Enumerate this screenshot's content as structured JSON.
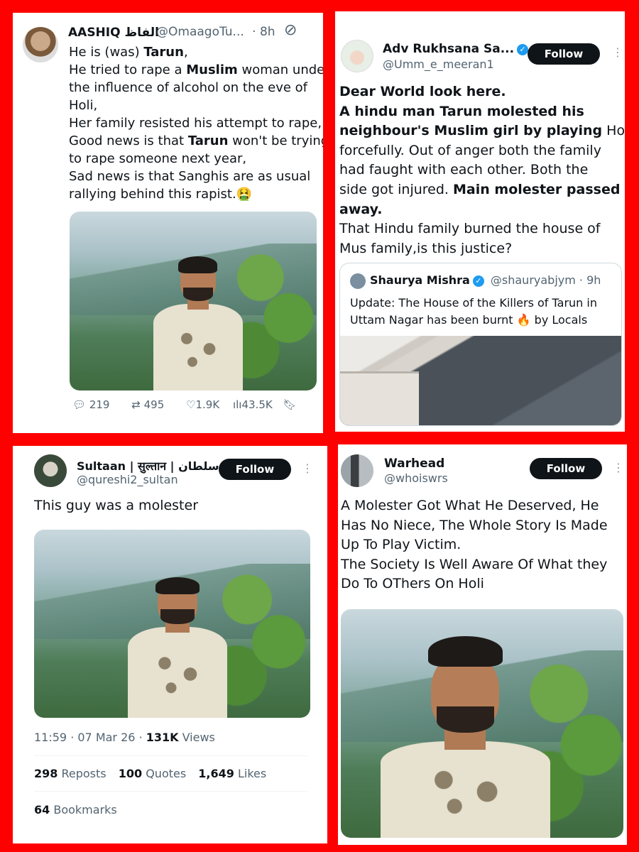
{
  "panel1": {
    "name": "AASHIQ الفاظ",
    "handle": "@OmaagoTu...",
    "time": "· 8h",
    "lines": [
      [
        "He is (was) ",
        "Tarun",
        ","
      ],
      [
        "He tried to rape a ",
        "Muslim",
        " woman under"
      ],
      [
        "the influence of alcohol on the eve of",
        "",
        ""
      ],
      [
        "Holi,",
        "",
        ""
      ],
      [
        "Her family resisted his attempt to rape,",
        "",
        ""
      ],
      [
        "Good news is that ",
        "Tarun",
        " won't be trying"
      ],
      [
        "to rape someone next year,",
        "",
        ""
      ],
      [
        "Sad news is that Sanghis are as usual",
        "",
        ""
      ],
      [
        "rallying behind this rapist.🤮",
        "",
        ""
      ]
    ],
    "replies": "219",
    "reposts": "495",
    "likes": "1.9K",
    "views": "43.5K"
  },
  "panel2": {
    "name": "Adv Rukhsana Sa...",
    "handle": "@Umm_e_meeran1",
    "follow": "Follow",
    "lines": [
      [
        "",
        "Dear World look here.",
        ""
      ],
      [
        "",
        "A hindu man Tarun molested his",
        ""
      ],
      [
        "",
        "neighbour's Muslim girl by playing",
        " Holi"
      ],
      [
        "forcefully. Out of anger both the family",
        "",
        ""
      ],
      [
        "had faught with each other. Both the",
        "",
        ""
      ],
      [
        "side got injured. ",
        "Main molester passed",
        ""
      ],
      [
        "",
        "away.",
        ""
      ],
      [
        "That Hindu family burned the house of",
        "",
        ""
      ],
      [
        "Mus family,is this justice?",
        "",
        ""
      ]
    ],
    "quote": {
      "name": "Shaurya Mishra",
      "handle": "@shauryabjym",
      "time": "· 9h",
      "line1": "Update: The House of the Killers of Tarun in",
      "line2": "Uttam Nagar has been burnt 🔥 by Locals"
    }
  },
  "panel3": {
    "name": "Sultaan | सुल्तान | سلطان",
    "handle": "@qureshi2_sultan",
    "follow": "Follow",
    "text": "This guy was a molester",
    "timestamp": "11:59 · 07 Mar 26 · ",
    "views_count": "131K",
    "views_label": " Views",
    "reposts_count": "298",
    "reposts_label": " Reposts",
    "quotes_count": "100",
    "quotes_label": " Quotes",
    "likes_count": "1,649",
    "likes_label": " Likes",
    "bookmarks_count": "64",
    "bookmarks_label": " Bookmarks"
  },
  "panel4": {
    "name": "Warhead",
    "handle": "@whoiswrs",
    "follow": "Follow",
    "lines": [
      "A Molester Got What He Deserved, He",
      "Has No Niece, The Whole Story Is Made",
      "Up To Play Victim.",
      "The Society Is Well Aware Of What they",
      "Do To OThers On Holi"
    ]
  }
}
